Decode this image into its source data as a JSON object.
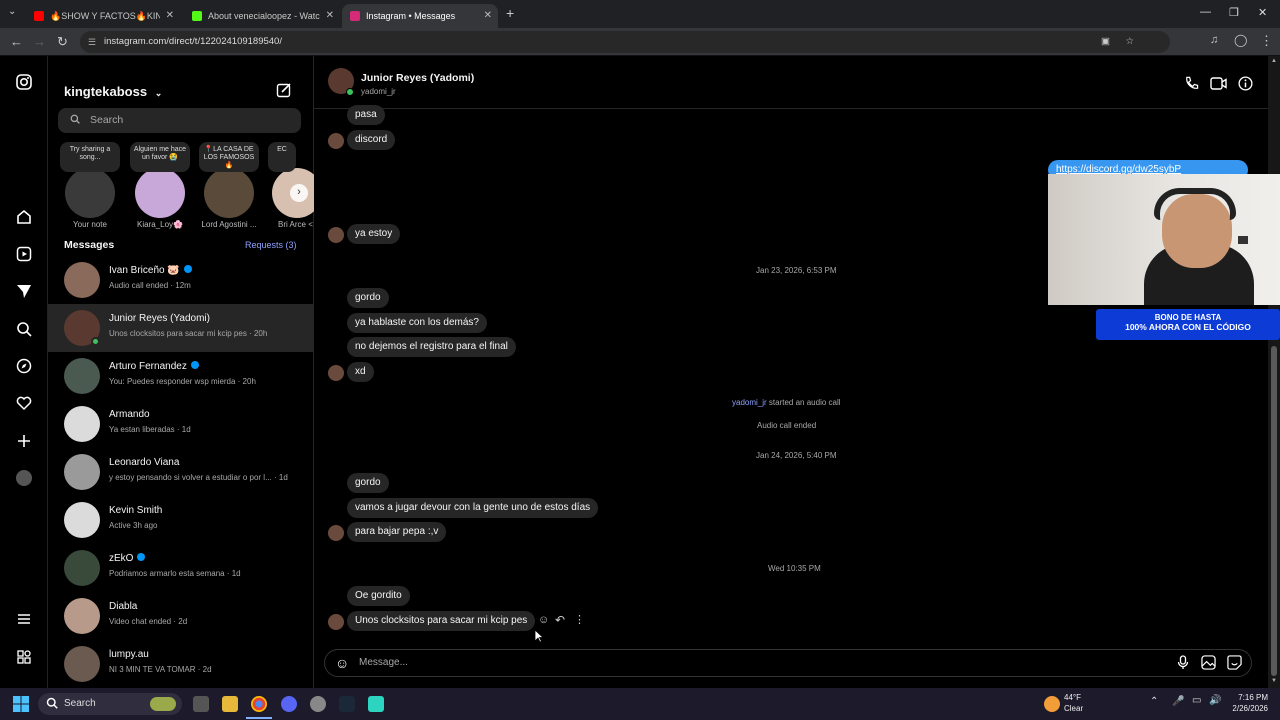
{
  "browser": {
    "tabs": [
      {
        "title": "🔥SHOW Y FACTOS🔥KINGTEK",
        "favicon_color": "#ff0000"
      },
      {
        "title": "About venecialoopez - Watch Li",
        "favicon_color": "#53fc18"
      },
      {
        "title": "Instagram • Messages",
        "favicon_color": "#d62976"
      }
    ],
    "url": "instagram.com/direct/t/122024109189540/"
  },
  "sidebar": {
    "username": "kingtekaboss",
    "search_placeholder": "Search",
    "notes": [
      {
        "bubble": "Try sharing a song...",
        "label": "Your note"
      },
      {
        "bubble": "Alguien me hace un favor 😭",
        "label": "Kiara_Loy🌸"
      },
      {
        "bubble": "📍LA CASA DE LOS FAMOSOS 🔥",
        "label": "Lord Agostini ..."
      },
      {
        "bubble": "EC",
        "label": "Bri Arce <"
      }
    ],
    "messages_heading": "Messages",
    "requests_label": "Requests (3)",
    "conversations": [
      {
        "name": "Ivan Briceño 🐷",
        "preview": "Audio call ended · 12m",
        "verified": true,
        "color": "#8a6a5a"
      },
      {
        "name": "Junior Reyes (Yadomi)",
        "preview": "Unos clocksitos para sacar mi kcip pes · 20h",
        "verified": false,
        "color": "#5a3a30"
      },
      {
        "name": "Arturo Fernandez",
        "preview": "You: Puedes responder wsp mierda · 20h",
        "verified": true,
        "color": "#4a5a50"
      },
      {
        "name": "Armando",
        "preview": "Ya estan liberadas · 1d",
        "verified": false,
        "color": "#dbdbdb"
      },
      {
        "name": "Leonardo Viana",
        "preview": "y estoy pensando si volver a estudiar o por l... · 1d",
        "verified": false,
        "color": "#9a9a9a"
      },
      {
        "name": "Kevin Smith",
        "preview": "Active 3h ago",
        "verified": false,
        "color": "#dbdbdb"
      },
      {
        "name": "zEkO",
        "preview": "Podriamos armarlo esta semana · 1d",
        "verified": true,
        "color": "#3a4a3a"
      },
      {
        "name": "Diabla",
        "preview": "Video chat ended · 2d",
        "verified": false,
        "color": "#b89a8a"
      },
      {
        "name": "lumpy.au",
        "preview": "NI 3 MIN TE VA TOMAR · 2d",
        "verified": false,
        "color": "#6a5a50"
      }
    ]
  },
  "chat": {
    "contact_name": "Junior Reyes (Yadomi)",
    "contact_handle": "yadomi_jr",
    "messages": [
      {
        "text": "pasa"
      },
      {
        "text": "discord"
      },
      {
        "text": "https://discord.gg/dw25sybP"
      },
      {
        "text": "ya estoy"
      },
      {
        "text": "Jan 23, 2026, 6:53 PM"
      },
      {
        "text": "gordo"
      },
      {
        "text": "ya hablaste con los demás?"
      },
      {
        "text": "no dejemos el registro para el final"
      },
      {
        "text": "xd"
      },
      {
        "text": "yadomi_jr"
      },
      {
        "text": "started an audio call"
      },
      {
        "text": "Audio call ended"
      },
      {
        "text": "Jan 24, 2026, 5:40 PM"
      },
      {
        "text": "gordo"
      },
      {
        "text": "vamos a jugar devour con la gente uno de estos días"
      },
      {
        "text": "para bajar pepa :,v"
      },
      {
        "text": "Wed 10:35 PM"
      },
      {
        "text": "Oe gordito"
      },
      {
        "text": "Unos clocksitos para sacar mi kcip pes"
      }
    ],
    "composer_placeholder": "Message..."
  },
  "overlay": {
    "banner_line1": "BONO DE HASTA",
    "banner_line2": "100% AHORA CON EL CÓDIGO"
  },
  "taskbar": {
    "search_label": "Search",
    "weather_temp": "44°F",
    "weather_cond": "Clear",
    "time": "7:16 PM",
    "date": "2/26/2026"
  }
}
